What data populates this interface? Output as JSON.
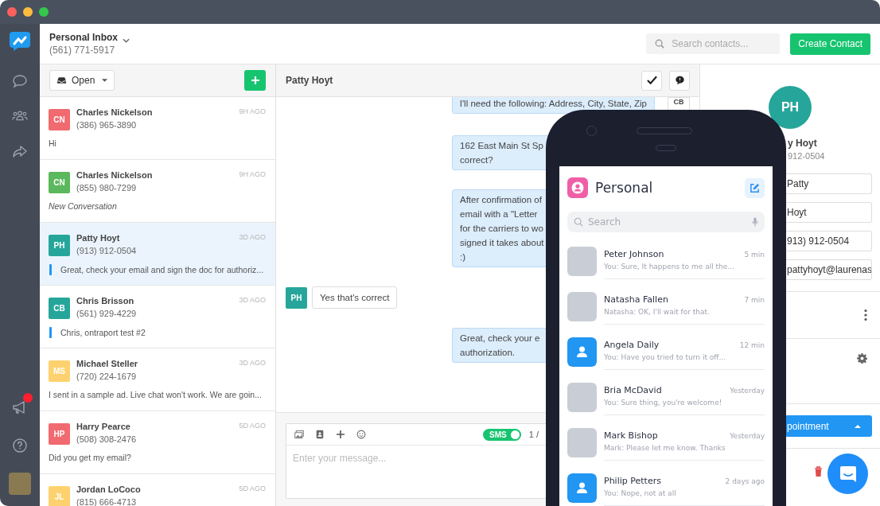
{
  "inbox": {
    "name": "Personal Inbox",
    "phone": "(561) 771-5917"
  },
  "rail": {
    "announcements_unread": true
  },
  "header": {
    "search_placeholder": "Search contacts...",
    "create_button": "Create Contact"
  },
  "list": {
    "filter": "Open",
    "conversations": [
      {
        "initials": "CN",
        "color": "#f06a70",
        "name": "Charles Nickelson",
        "phone": "(386) 965-3890",
        "time": "9H AGO",
        "preview": {
          "kind": "plain",
          "text": "Hi"
        },
        "selected": false
      },
      {
        "initials": "CN",
        "color": "#5cb85c",
        "name": "Charles Nickelson",
        "phone": "(855) 980-7299",
        "time": "9H AGO",
        "preview": {
          "kind": "system",
          "text": "New Conversation"
        },
        "selected": false
      },
      {
        "initials": "PH",
        "color": "#26a69a",
        "name": "Patty Hoyt",
        "phone": "(913) 912-0504",
        "time": "3D AGO",
        "preview": {
          "kind": "note",
          "text": "Great, check your email and sign the doc for authoriz..."
        },
        "selected": true
      },
      {
        "initials": "CB",
        "color": "#26a69a",
        "name": "Chris Brisson",
        "phone": "(561) 929-4229",
        "time": "3D AGO",
        "preview": {
          "kind": "note",
          "text": "Chris, ontraport test #2"
        },
        "selected": false
      },
      {
        "initials": "MS",
        "color": "#fdd26e",
        "name": "Michael Steller",
        "phone": "(720) 224-1679",
        "time": "3D AGO",
        "preview": {
          "kind": "plain",
          "text": "I sent in a sample ad. Live chat won't work. We are goin..."
        },
        "selected": false
      },
      {
        "initials": "HP",
        "color": "#f06a70",
        "name": "Harry Pearce",
        "phone": "(508) 308-2476",
        "time": "5D AGO",
        "preview": {
          "kind": "plain",
          "text": "Did you get my email?"
        },
        "selected": false
      },
      {
        "initials": "JL",
        "color": "#fdd26e",
        "name": "Jordan LoCoco",
        "phone": "(815) 666-4713",
        "time": "5D AGO",
        "selected": false
      }
    ]
  },
  "conversation": {
    "title": "Patty Hoyt",
    "messages": [
      {
        "kind": "sent",
        "lines": [
          "I'll need the following: Address, City, State, Zip"
        ],
        "avatar": "CB"
      },
      {
        "kind": "sent",
        "lines": [
          "162 East Main St Sp",
          "correct?"
        ]
      },
      {
        "kind": "sent",
        "lines": [
          "After confirmation of",
          "email with a \"Letter",
          "for the carriers to wo",
          "signed it takes about",
          ":)"
        ]
      },
      {
        "kind": "received",
        "lines": [
          "Yes that's correct"
        ],
        "avatar": "PH",
        "color": "#26a69a"
      },
      {
        "kind": "sent",
        "lines": [
          "Great, check your e",
          "authorization."
        ]
      }
    ],
    "composer": {
      "placeholder": "Enter your message...",
      "sms_label": "SMS",
      "sms_on": true,
      "counter": "1 /"
    }
  },
  "contact_panel": {
    "initials": "PH",
    "name": "y Hoyt",
    "phone": "912-0504",
    "fields": [
      "Patty",
      "Hoyt",
      "913) 912-0504",
      "pattyhoyt@laurenas"
    ],
    "action_button": "pointment"
  },
  "phone": {
    "title": "Personal",
    "search_placeholder": "Search",
    "chats": [
      {
        "name": "Peter Johnson",
        "preview": "You: Sure, It happens to me all the...",
        "time": "5 min",
        "kind": "photo"
      },
      {
        "name": "Natasha Fallen",
        "preview": "Natasha: OK, I'll wait for that.",
        "time": "7 min",
        "kind": "photo"
      },
      {
        "name": "Angela Daily",
        "preview": "You: Have you tried to turn it off...",
        "time": "12 min",
        "kind": "icon"
      },
      {
        "name": "Bria McDavid",
        "preview": "You: Sure thing, you're welcome!",
        "time": "Yesterday",
        "kind": "photo"
      },
      {
        "name": "Mark Bishop",
        "preview": "Mark: Please let me know. Thanks",
        "time": "Yesterday",
        "kind": "photo"
      },
      {
        "name": "Philip Petters",
        "preview": "You: Nope, not at all",
        "time": "2 days ago",
        "kind": "icon"
      }
    ]
  }
}
